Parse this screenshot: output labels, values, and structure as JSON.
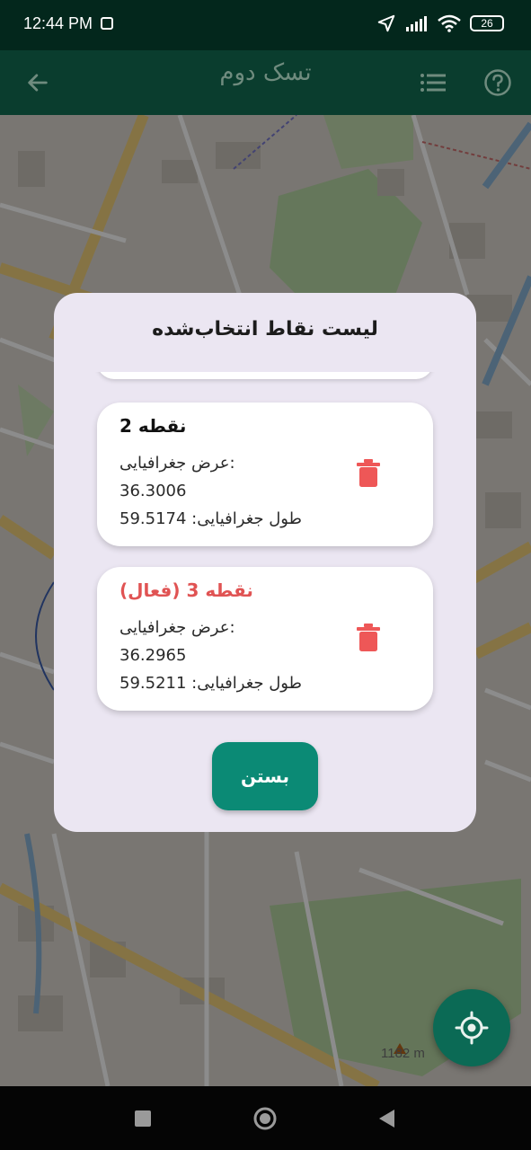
{
  "status_bar": {
    "time": "12:44 PM",
    "battery": "26"
  },
  "app_bar": {
    "title": "تسک دوم",
    "back_icon": "arrow-left-icon",
    "list_icon": "list-icon",
    "help_icon": "help-circle-icon"
  },
  "map": {
    "elevation_label": "1182 m",
    "locate_icon": "crosshair-icon"
  },
  "dialog": {
    "title": "لیست نقاط انتخاب‌شده",
    "points": [
      {
        "name": "نقطه 2",
        "latitude_label": "عرض جغرافیایی:",
        "latitude": "36.3006",
        "longitude_line": "طول جغرافیایی: 59.5174",
        "active": false
      },
      {
        "name": "نقطه 3 (فعال)",
        "latitude_label": "عرض جغرافیایی:",
        "latitude": "36.2965",
        "longitude_line": "طول جغرافیایی: 59.5211",
        "active": true
      }
    ],
    "close_label": "بستن"
  },
  "colors": {
    "app_bar": "#0a3d2e",
    "accent": "#0b8a75",
    "delete": "#ee5757",
    "active_point": "#e05353"
  }
}
